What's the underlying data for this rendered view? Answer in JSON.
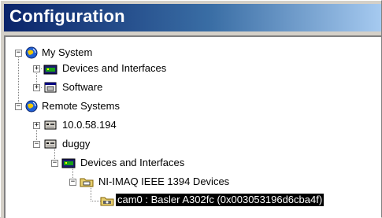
{
  "window": {
    "title": "Configuration"
  },
  "tree": {
    "my_system": "My System",
    "my_system_devices": "Devices and Interfaces",
    "my_system_software": "Software",
    "remote_systems": "Remote Systems",
    "remote_ip": "10.0.58.194",
    "remote_duggy": "duggy",
    "duggy_devices": "Devices and Interfaces",
    "imaq_devices": "NI-IMAQ IEEE 1394 Devices",
    "cam0": "cam0 : Basler A302fc (0x003053196d6cba4f)"
  },
  "expanders": {
    "plus": "+",
    "minus": "−"
  },
  "colors": {
    "selection": "#000000",
    "title_start": "#0a246a",
    "title_end": "#a6caf0"
  }
}
